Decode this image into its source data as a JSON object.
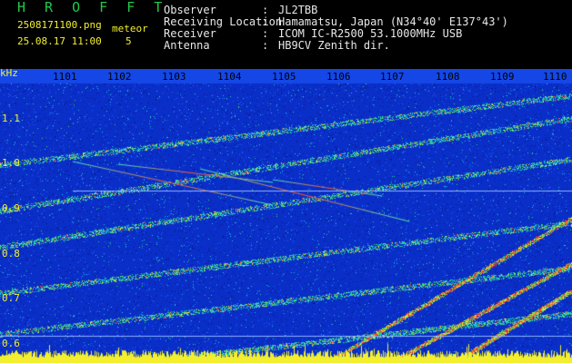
{
  "header": {
    "title": "H R O F F T",
    "filename": "2508171100.png",
    "datetime": "25.08.17 11:00",
    "meteor_label": "meteor",
    "meteor_count": "5",
    "info": [
      {
        "label": "Observer",
        "value": "JL2TBB"
      },
      {
        "label": "Receiving Location",
        "value": "Hamamatsu, Japan (N34°40' E137°43')"
      },
      {
        "label": "Receiver",
        "value": "ICOM IC-R2500 53.1000MHz USB"
      },
      {
        "label": "Antenna",
        "value": "HB9CV Zenith dir."
      }
    ],
    "separator": ":"
  },
  "axes": {
    "y_unit": "kHz",
    "y_ticks": [
      "1.1",
      "1.0",
      "0.9",
      "0.8",
      "0.7",
      "0.6"
    ],
    "x_ticks": [
      "1101",
      "1102",
      "1103",
      "1104",
      "1105",
      "1106",
      "1107",
      "1108",
      "1109",
      "1110"
    ]
  },
  "colors": {
    "background": "#000000",
    "header_text": "#f3ef2e",
    "title_text": "#22c84a",
    "info_text": "#e8e8e8",
    "spectrogram_base": "#0a2ec8",
    "noise_floor": "#f3ef2e"
  }
}
